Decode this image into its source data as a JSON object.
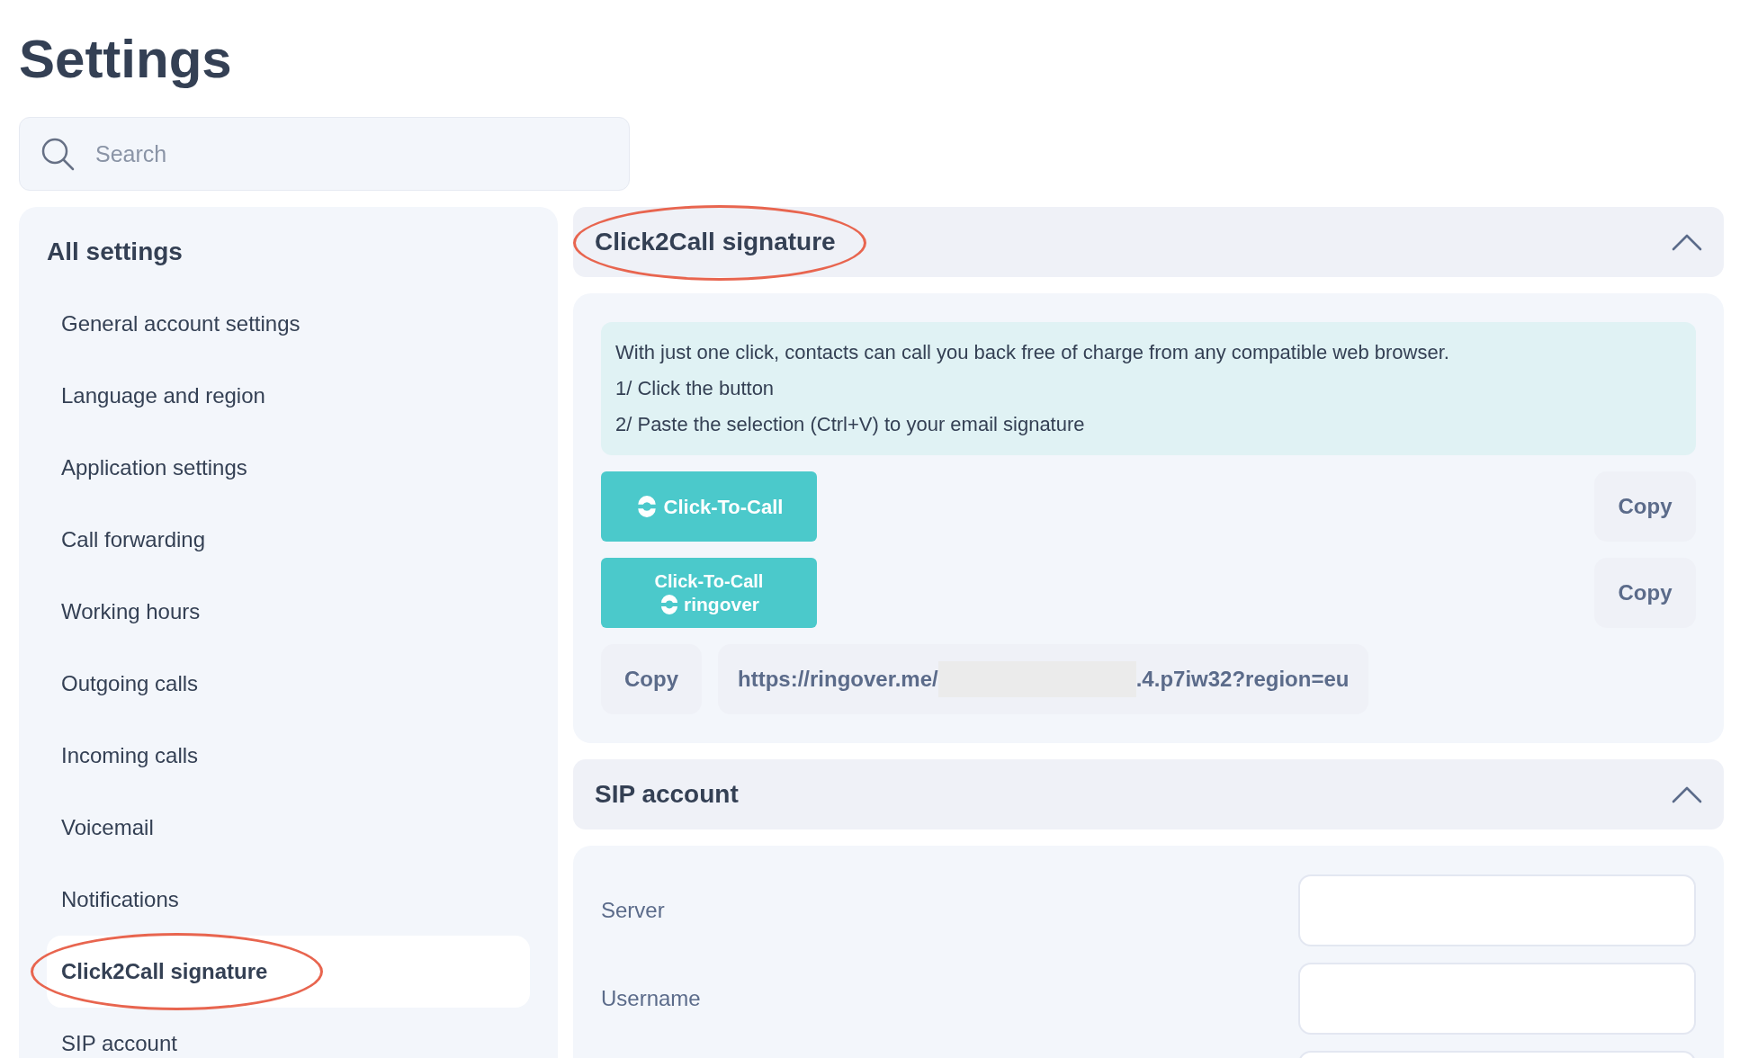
{
  "page_title": "Settings",
  "search": {
    "placeholder": "Search"
  },
  "sidebar": {
    "heading": "All settings",
    "items": [
      {
        "label": "General account settings",
        "selected": false,
        "circled": false
      },
      {
        "label": "Language and region",
        "selected": false,
        "circled": false
      },
      {
        "label": "Application settings",
        "selected": false,
        "circled": false
      },
      {
        "label": "Call forwarding",
        "selected": false,
        "circled": false
      },
      {
        "label": "Working hours",
        "selected": false,
        "circled": false
      },
      {
        "label": "Outgoing calls",
        "selected": false,
        "circled": false
      },
      {
        "label": "Incoming calls",
        "selected": false,
        "circled": false
      },
      {
        "label": "Voicemail",
        "selected": false,
        "circled": false
      },
      {
        "label": "Notifications",
        "selected": false,
        "circled": false
      },
      {
        "label": "Click2Call signature",
        "selected": true,
        "circled": true
      },
      {
        "label": "SIP account",
        "selected": false,
        "circled": false
      }
    ]
  },
  "click2call": {
    "title": "Click2Call signature",
    "circled": true,
    "expanded": true,
    "info_lines": [
      "With just one click, contacts can call you back free of charge from any compatible web browser.",
      "1/ Click the button",
      "2/ Paste the selection (Ctrl+V) to your email signature"
    ],
    "buttons": [
      {
        "kind": "simple",
        "label": "Click-To-Call",
        "copy": "Copy"
      },
      {
        "kind": "branded",
        "label": "Click-To-Call",
        "brand": "ringover",
        "copy": "Copy"
      }
    ],
    "link": {
      "copy": "Copy",
      "url_start": "https://ringover.me/",
      "url_end": ".4.p7iw32?region=eu",
      "redacted": true
    }
  },
  "sip": {
    "title": "SIP account",
    "expanded": true,
    "fields": [
      {
        "label": "Server"
      },
      {
        "label": "Username"
      }
    ],
    "more_fields_below": true
  }
}
